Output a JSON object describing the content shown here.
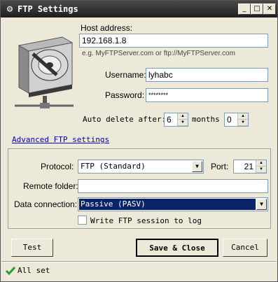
{
  "window": {
    "title": "FTP Settings"
  },
  "titlebar_buttons": {
    "minimize": "_",
    "maximize": "□",
    "close": "✕"
  },
  "host": {
    "label": "Host address:",
    "value": "192.168.1.8",
    "hint": "e.g. MyFTPServer.com or ftp://MyFTPServer.com"
  },
  "username": {
    "label": "Username:",
    "value": "lyhabc"
  },
  "password": {
    "label": "Password:",
    "value": "********"
  },
  "auto_delete": {
    "label": "Auto delete after:",
    "months_value": "6",
    "months_label": "months",
    "days_value": "0"
  },
  "advanced_link": "Advanced FTP settings",
  "protocol": {
    "label": "Protocol:",
    "value": "FTP (Standard)"
  },
  "port": {
    "label": "Port:",
    "value": "21"
  },
  "remote_folder": {
    "label": "Remote folder:",
    "value": ""
  },
  "data_connection": {
    "label": "Data connection:",
    "value": "Passive (PASV)"
  },
  "write_log": {
    "label": "Write FTP session to log",
    "checked": false
  },
  "buttons": {
    "test": "Test",
    "save_close": "Save & Close",
    "cancel": "Cancel"
  },
  "status": {
    "text": "All set",
    "icon": "checkmark-icon"
  },
  "colors": {
    "titlebar": "#2b2b2b",
    "select_highlight": "#0a246a",
    "status_check": "#2e9a2e",
    "link": "#0000cc"
  }
}
